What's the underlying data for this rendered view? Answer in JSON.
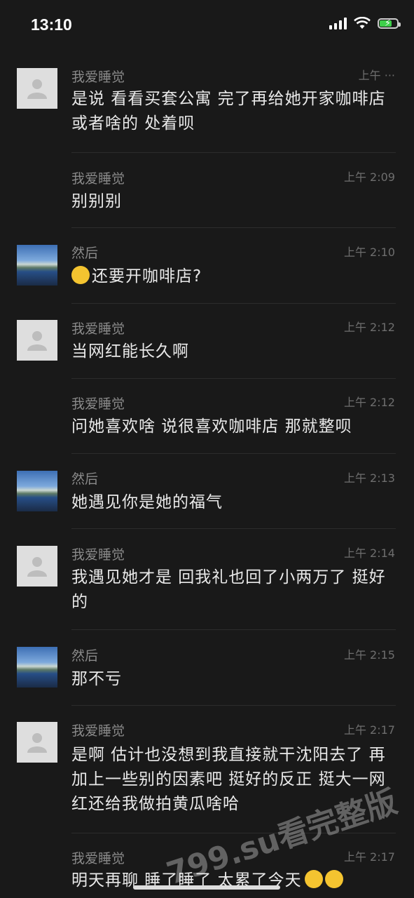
{
  "status_bar": {
    "time": "13:10"
  },
  "messages": [
    {
      "sender": "我爱睡觉",
      "time": "上午 ···",
      "text": "是说 看看买套公寓 完了再给她开家咖啡店或者啥的 处着呗"
    },
    {
      "sender": "我爱睡觉",
      "time": "上午 2:09",
      "text": "别别别"
    },
    {
      "sender": "然后",
      "time": "上午 2:10",
      "text": "还要开咖啡店?"
    },
    {
      "sender": "我爱睡觉",
      "time": "上午 2:12",
      "text": "当网红能长久啊"
    },
    {
      "sender": "我爱睡觉",
      "time": "上午 2:12",
      "text": "问她喜欢啥 说很喜欢咖啡店 那就整呗"
    },
    {
      "sender": "然后",
      "time": "上午 2:13",
      "text": "她遇见你是她的福气"
    },
    {
      "sender": "我爱睡觉",
      "time": "上午 2:14",
      "text": "我遇见她才是 回我礼也回了小两万了 挺好的"
    },
    {
      "sender": "然后",
      "time": "上午 2:15",
      "text": "那不亏"
    },
    {
      "sender": "我爱睡觉",
      "time": "上午 2:17",
      "text": "是啊 估计也没想到我直接就干沈阳去了 再加上一些别的因素吧 挺好的反正 挺大一网红还给我做拍黄瓜啥哈"
    },
    {
      "sender": "我爱睡觉",
      "time": "上午 2:17",
      "text": "明天再聊 睡了睡了 太累了今天"
    }
  ],
  "watermark": "799.su看完整版",
  "icons": {
    "back": "chevron-left-icon",
    "wifi": "wifi-icon",
    "battery": "battery-charging-icon"
  },
  "colors": {
    "background": "#191919",
    "text": "#e9e9e9",
    "meta": "#8a8a8a"
  }
}
